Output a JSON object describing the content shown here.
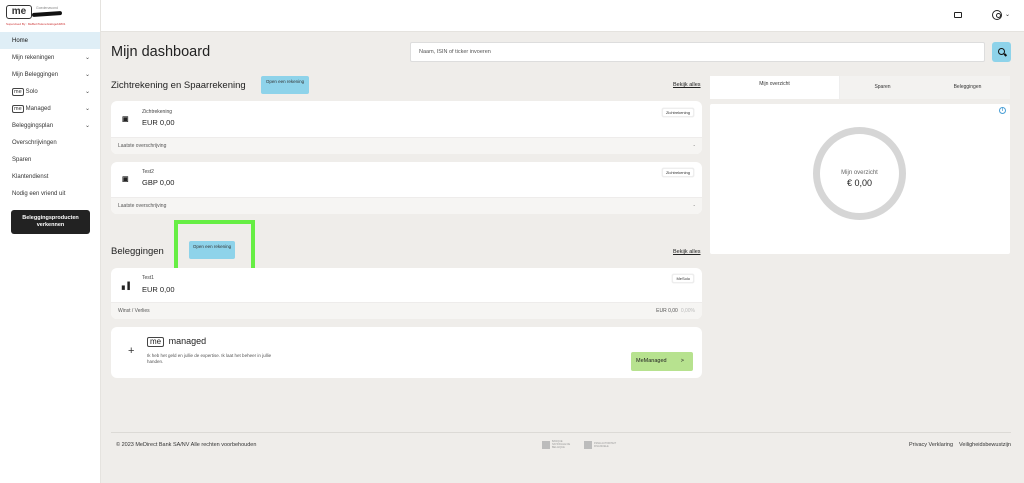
{
  "brand": {
    "logo_text": "me",
    "subtitle": "Goedenavond",
    "supervisor_line": "Supervised By : MeBeCTeleneGiaGgeb4831"
  },
  "sidebar": {
    "items": [
      {
        "label": "Home",
        "chevron": false
      },
      {
        "label": "Mijn rekeningen",
        "chevron": true
      },
      {
        "label": "Mijn Beleggingen",
        "chevron": true
      },
      {
        "label": "Solo",
        "badge": "me",
        "chevron": true
      },
      {
        "label": "Managed",
        "badge": "me",
        "chevron": true
      },
      {
        "label": "Beleggingsplan",
        "chevron": true
      },
      {
        "label": "Overschrijvingen",
        "chevron": false
      },
      {
        "label": "Sparen",
        "chevron": false
      },
      {
        "label": "Klantendienst",
        "chevron": false
      },
      {
        "label": "Nodig een vriend uit",
        "chevron": false
      }
    ],
    "explore_button": "Beleggingsproducten verkennen"
  },
  "header": {
    "title": "Mijn dashboard",
    "search_placeholder": "Naam, ISIN of ticker invoeren"
  },
  "accounts_section": {
    "title": "Zichtrekening en Spaarrekening",
    "open_button": "Open een rekening",
    "see_all": "Bekijk alles",
    "cards": [
      {
        "name": "Zichtrekening",
        "amount": "EUR 0,00",
        "tag": "Zichtrekening",
        "footer_label": "Laatste overschrijving",
        "footer_value": "-"
      },
      {
        "name": "Test2",
        "amount": "GBP 0,00",
        "tag": "Zichtrekening",
        "footer_label": "Laatste overschrijving",
        "footer_value": "-"
      }
    ]
  },
  "investments_section": {
    "title": "Beleggingen",
    "open_button": "Open een rekening",
    "see_all": "Bekijk alles",
    "card": {
      "name": "Test1",
      "amount": "EUR 0,00",
      "tag": "MeSolo",
      "footer_label": "Winst / Verlies",
      "footer_value": "EUR 0,00",
      "footer_gain": "0,00%"
    },
    "managed": {
      "plus": "+",
      "logo_badge": "me",
      "logo_word": "managed",
      "description": "Ik heb het geld en jullie de expertise. Ik laat het beheer in jullie handen.",
      "button": "MeManaged",
      "button_arrow": ">"
    }
  },
  "overview": {
    "tabs": [
      {
        "label": "Mijn overzicht",
        "selected": true
      },
      {
        "label": "Sparen",
        "selected": false
      },
      {
        "label": "Beleggingen",
        "selected": false
      }
    ],
    "ring_label": "Mijn overzicht",
    "ring_value": "€ 0,00",
    "info_glyph": "i"
  },
  "footer": {
    "copyright": "© 2023 MeDirect Bank SA/NV Alle rechten voorbehouden",
    "logos": [
      "BANQUE NATIONALE DE BELGIQUE",
      "FSMA AUTORITEIT FINANCIELE"
    ],
    "links": [
      "Privacy Verklaring",
      "Veiligheidsbewustzijn"
    ]
  },
  "colors": {
    "accent": "#8ed3ea",
    "managed_button": "#b7e28f",
    "highlight": "#66ee44"
  }
}
